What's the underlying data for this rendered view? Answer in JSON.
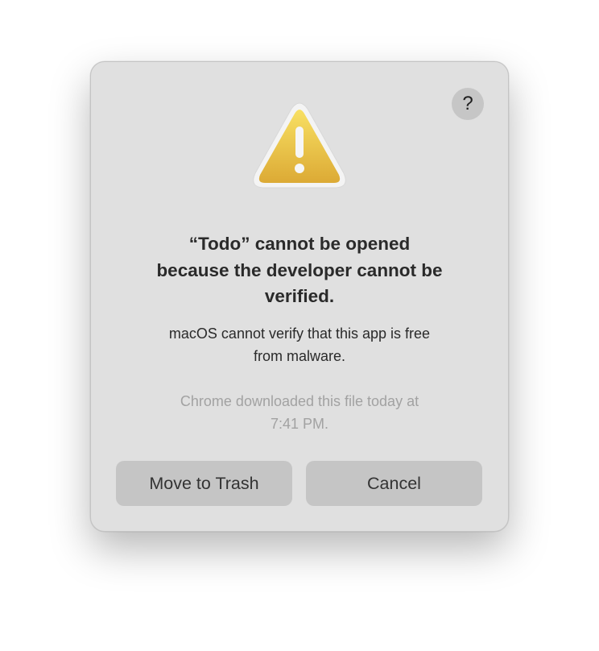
{
  "dialog": {
    "help_label": "?",
    "icon": "warning-triangle-icon",
    "title_lines": [
      "“Todo” cannot be opened",
      "because the developer cannot be",
      "verified."
    ],
    "body_lines": [
      "macOS cannot verify that this app is free",
      "from malware."
    ],
    "note_lines": [
      "Chrome downloaded this file today at",
      "7:41 PM."
    ],
    "buttons": {
      "trash": "Move to Trash",
      "cancel": "Cancel"
    }
  },
  "colors": {
    "icon_top": "#f8e063",
    "icon_bottom": "#dcaa35",
    "background": "#e0e0e0",
    "button": "#c5c5c5"
  }
}
